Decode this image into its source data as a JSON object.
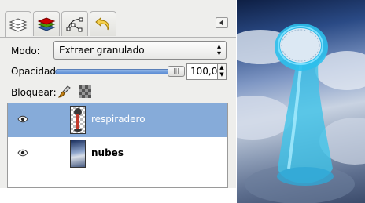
{
  "layers_panel": {
    "tabs": [
      {
        "name": "Capas",
        "icon": "layers-icon"
      },
      {
        "name": "Canales",
        "icon": "channels-icon"
      },
      {
        "name": "Rutas",
        "icon": "paths-icon"
      },
      {
        "name": "Deshacer",
        "icon": "undo-icon"
      }
    ],
    "mode_label": "Modo:",
    "mode_value": "Extraer granulado",
    "opacity_label": "Opacidad:",
    "opacity_value": "100,0",
    "opacity_level": 1.0,
    "lock_label": "Bloquear:",
    "lock_icons": [
      "brush-lock-icon",
      "alpha-lock-icon"
    ],
    "layers": [
      {
        "name": "respiradero",
        "visible": true,
        "selected": true,
        "bold": false
      },
      {
        "name": "nubes",
        "visible": true,
        "selected": false,
        "bold": true
      }
    ]
  },
  "colors": {
    "selection": "#86abd9",
    "panel_bg": "#eeeeec",
    "slider_fill": "#5a8bd3"
  }
}
